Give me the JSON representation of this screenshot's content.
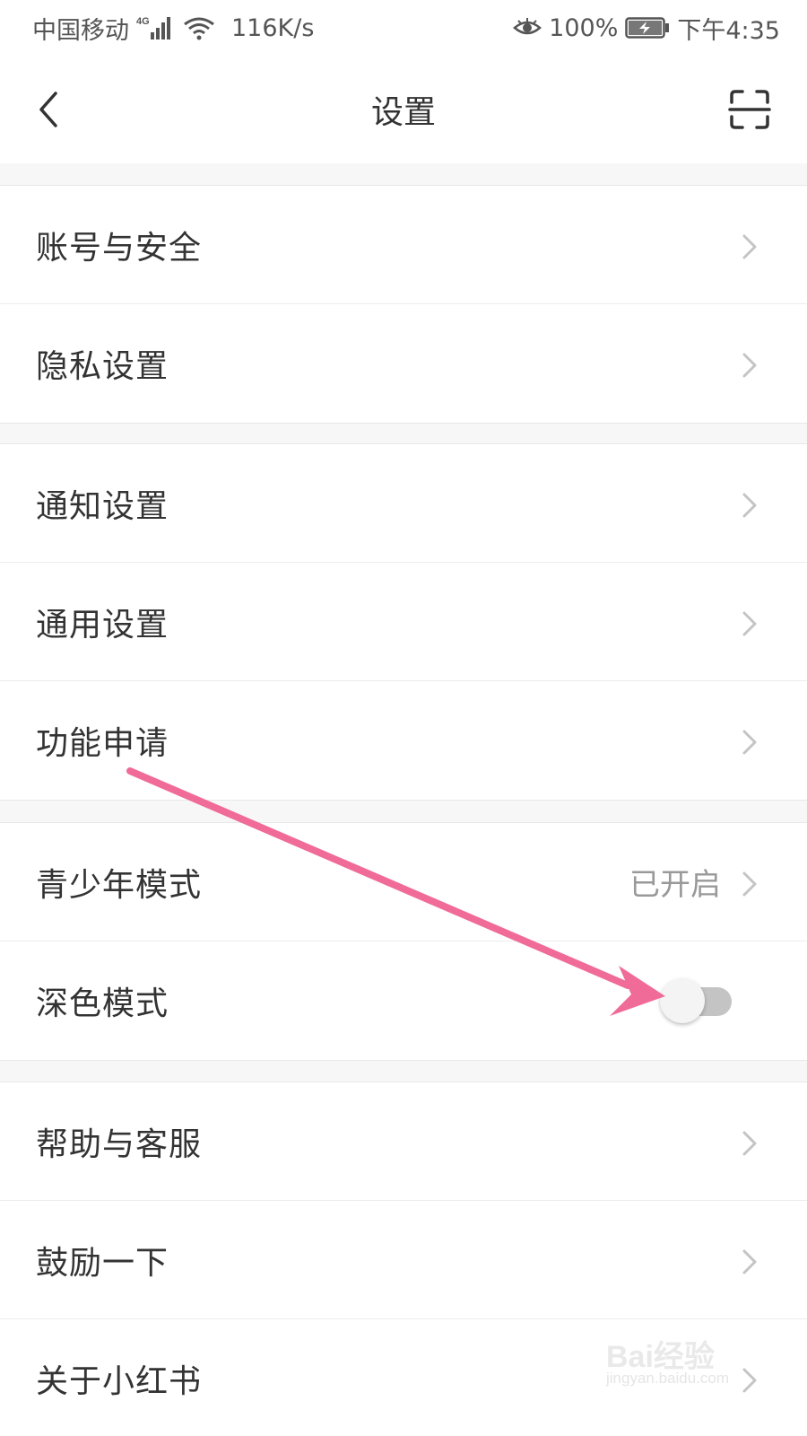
{
  "status_bar": {
    "carrier": "中国移动",
    "network_type": "4G",
    "speed": "116K/s",
    "battery": "100%",
    "time": "下午4:35"
  },
  "header": {
    "title": "设置"
  },
  "groups": [
    {
      "items": [
        {
          "label": "账号与安全"
        },
        {
          "label": "隐私设置"
        }
      ]
    },
    {
      "items": [
        {
          "label": "通知设置"
        },
        {
          "label": "通用设置"
        },
        {
          "label": "功能申请"
        }
      ]
    },
    {
      "items": [
        {
          "label": "青少年模式",
          "value": "已开启"
        },
        {
          "label": "深色模式",
          "toggle_on": false
        }
      ]
    },
    {
      "items": [
        {
          "label": "帮助与客服"
        },
        {
          "label": "鼓励一下"
        },
        {
          "label": "关于小红书"
        }
      ]
    }
  ],
  "colors": {
    "annotation_arrow": "#f06b97",
    "toggle_off_track": "#c4c4c4"
  },
  "watermark": {
    "logo": "Bai经验",
    "url": "jingyan.baidu.com"
  }
}
